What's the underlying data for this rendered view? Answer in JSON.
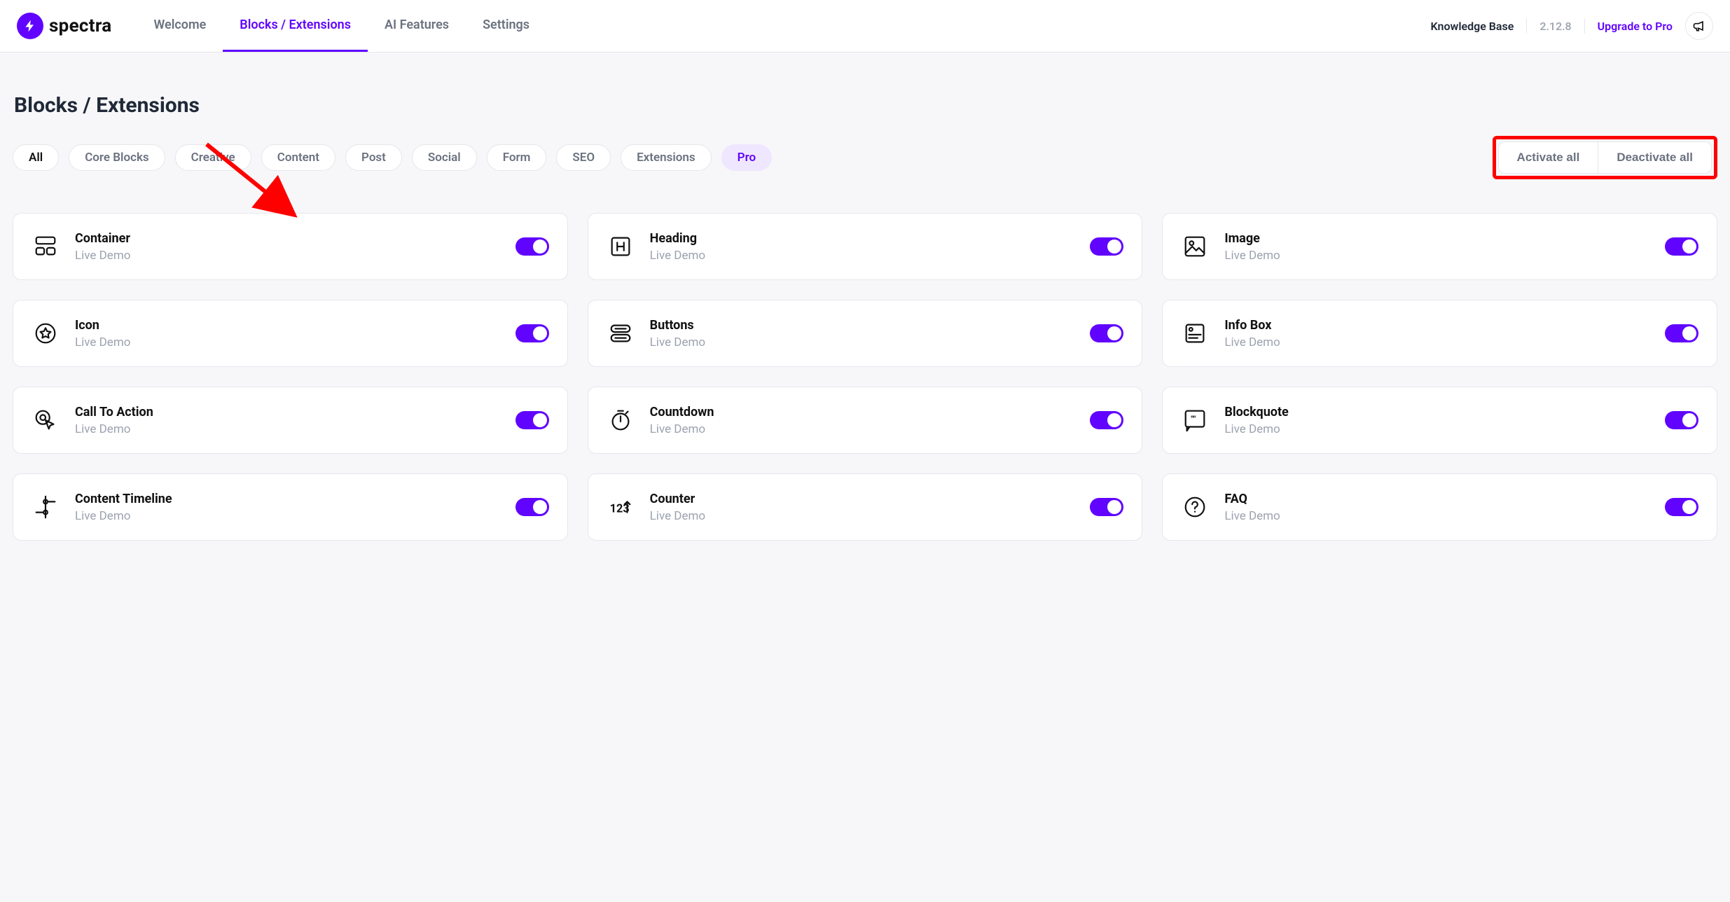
{
  "brand": "spectra",
  "nav": {
    "items": [
      {
        "id": "welcome",
        "label": "Welcome",
        "active": false
      },
      {
        "id": "blocks-extensions",
        "label": "Blocks / Extensions",
        "active": true
      },
      {
        "id": "ai-features",
        "label": "AI Features",
        "active": false
      },
      {
        "id": "settings",
        "label": "Settings",
        "active": false
      }
    ]
  },
  "header_right": {
    "knowledge_base": "Knowledge Base",
    "version": "2.12.8",
    "upgrade": "Upgrade to Pro"
  },
  "page_title": "Blocks / Extensions",
  "filters": [
    {
      "id": "all",
      "label": "All",
      "active": true
    },
    {
      "id": "core",
      "label": "Core Blocks"
    },
    {
      "id": "creative",
      "label": "Creative"
    },
    {
      "id": "content",
      "label": "Content"
    },
    {
      "id": "post",
      "label": "Post"
    },
    {
      "id": "social",
      "label": "Social"
    },
    {
      "id": "form",
      "label": "Form"
    },
    {
      "id": "seo",
      "label": "SEO"
    },
    {
      "id": "extensions",
      "label": "Extensions"
    },
    {
      "id": "pro",
      "label": "Pro",
      "pro": true
    }
  ],
  "actions": {
    "activate": "Activate all",
    "deactivate": "Deactivate all"
  },
  "live_demo_label": "Live Demo",
  "blocks": [
    {
      "id": "container",
      "title": "Container",
      "enabled": true,
      "icon": "container"
    },
    {
      "id": "heading",
      "title": "Heading",
      "enabled": true,
      "icon": "heading"
    },
    {
      "id": "image",
      "title": "Image",
      "enabled": true,
      "icon": "image"
    },
    {
      "id": "icon",
      "title": "Icon",
      "enabled": true,
      "icon": "star-circle"
    },
    {
      "id": "buttons",
      "title": "Buttons",
      "enabled": true,
      "icon": "buttons"
    },
    {
      "id": "info-box",
      "title": "Info Box",
      "enabled": true,
      "icon": "info-box"
    },
    {
      "id": "cta",
      "title": "Call To Action",
      "enabled": true,
      "icon": "cta"
    },
    {
      "id": "countdown",
      "title": "Countdown",
      "enabled": true,
      "icon": "stopwatch"
    },
    {
      "id": "blockquote",
      "title": "Blockquote",
      "enabled": true,
      "icon": "blockquote"
    },
    {
      "id": "content-timeline",
      "title": "Content Timeline",
      "enabled": true,
      "icon": "timeline"
    },
    {
      "id": "counter",
      "title": "Counter",
      "enabled": true,
      "icon": "counter"
    },
    {
      "id": "faq",
      "title": "FAQ",
      "enabled": true,
      "icon": "faq"
    }
  ],
  "annotation": {
    "arrow_description": "red arrow pointing to first card toggle",
    "highlight_description": "red rectangle around Activate all / Deactivate all"
  }
}
